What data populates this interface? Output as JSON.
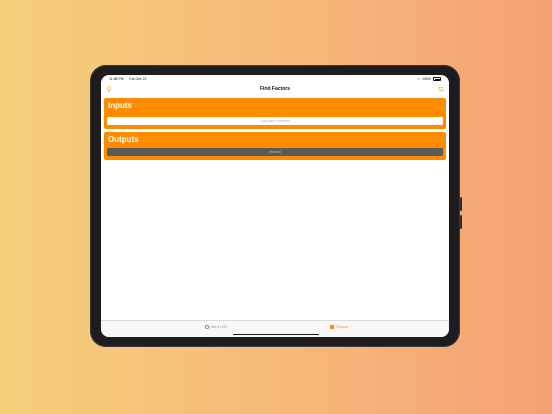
{
  "status_bar": {
    "time": "11:58 PM",
    "date": "Tue Dec 22",
    "battery": "100%"
  },
  "nav": {
    "title": "Find Factors",
    "left_icon": "bulb-icon",
    "right_icon": "refresh-icon"
  },
  "inputs": {
    "title": "Inputs",
    "placeholder": "# (positive number)"
  },
  "outputs": {
    "title": "Outputs",
    "value": "(factors)"
  },
  "tabs": [
    {
      "label": "Get a LCD",
      "icon": "circle-icon",
      "selected": false
    },
    {
      "label": "Factors",
      "icon": "square-icon",
      "selected": true
    }
  ],
  "colors": {
    "accent": "#ff8c00",
    "output_field": "#5a5a5a"
  }
}
